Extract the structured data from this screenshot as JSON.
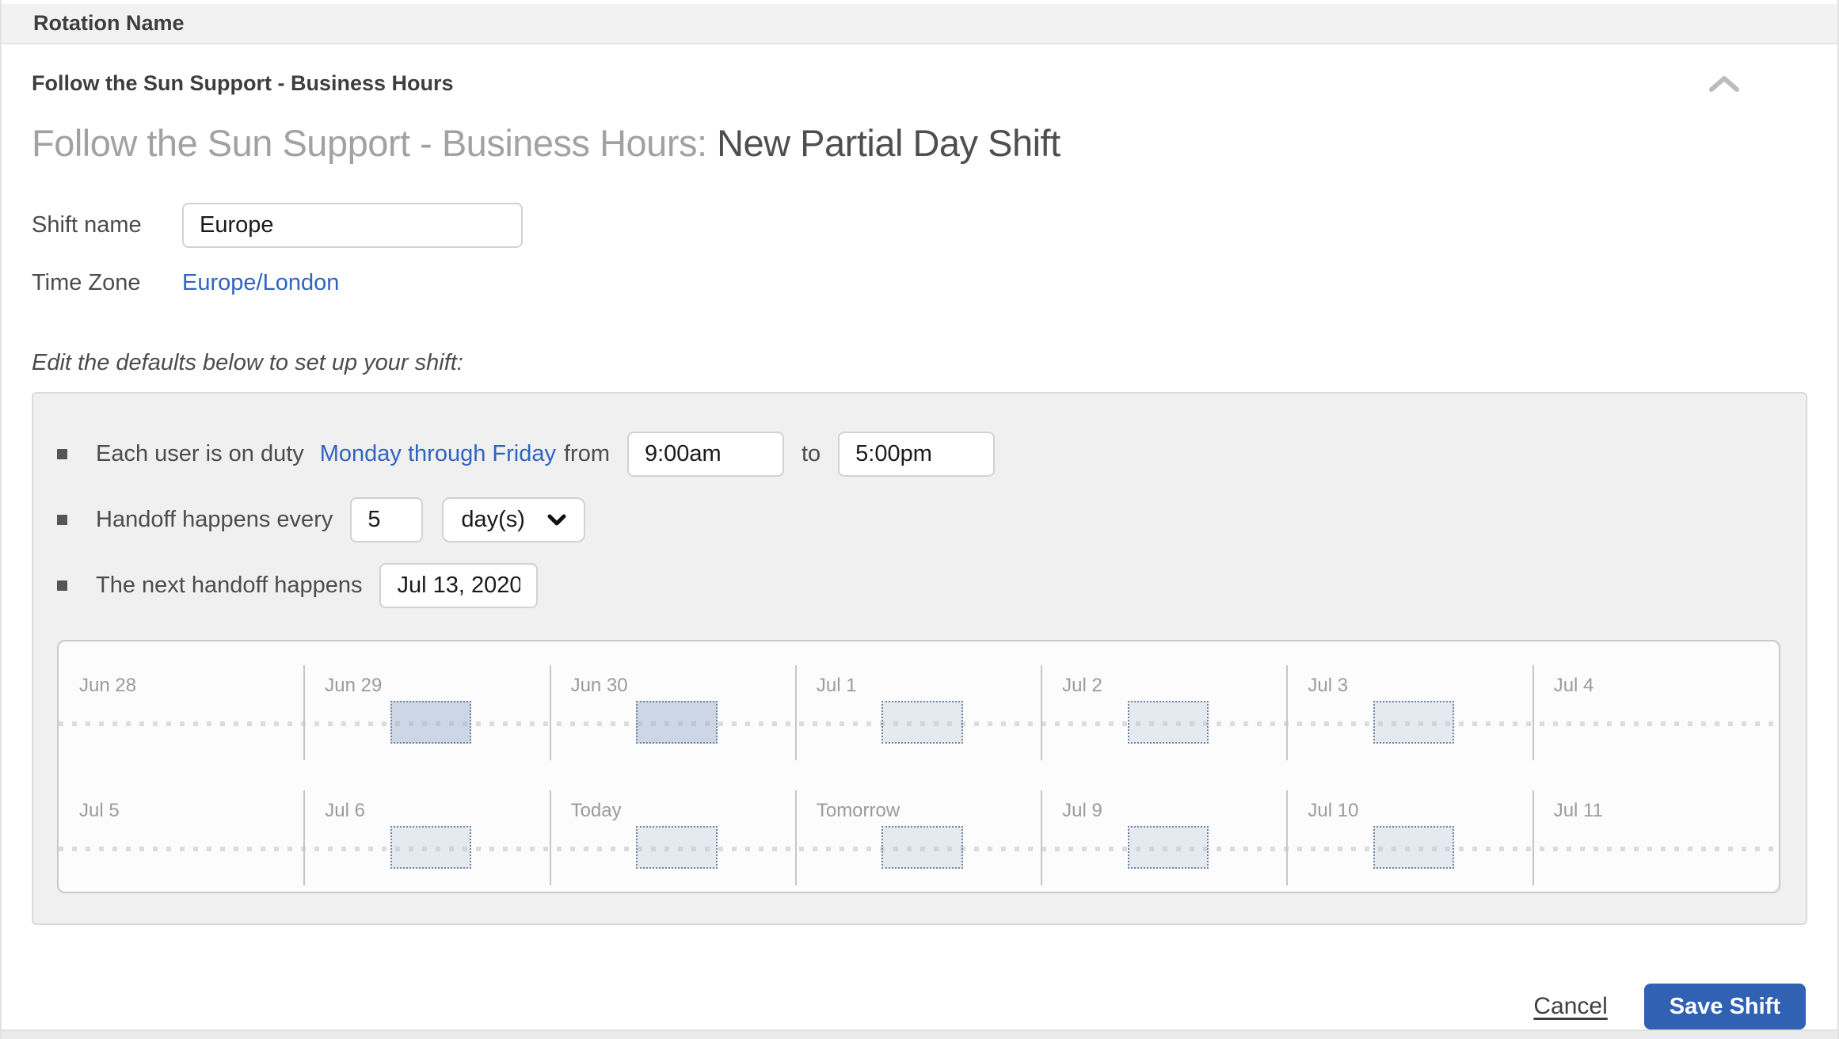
{
  "page": {
    "rotation_header": "Rotation Name"
  },
  "card": {
    "subtitle": "Follow the Sun Support - Business Hours",
    "title_prefix": "Follow the Sun Support - Business Hours:",
    "title_emphasis": "New Partial Day Shift",
    "shift_name": {
      "label": "Shift name",
      "value": "Europe"
    },
    "time_zone": {
      "label": "Time Zone",
      "value": "Europe/London"
    },
    "note": "Edit the defaults below to set up your shift:"
  },
  "defaults": {
    "duty": {
      "prefix": "Each user is on duty",
      "days_link": "Monday through Friday",
      "from_label": "from",
      "start_value": "9:00am",
      "to_label": "to",
      "end_value": "5:00pm"
    },
    "handoff": {
      "label": "Handoff happens every",
      "interval_value": "5",
      "unit_value": "day(s)"
    },
    "next_handoff": {
      "label": "The next handoff happens",
      "date_value": "Jul 13, 2020"
    }
  },
  "calendar": {
    "rows": [
      {
        "days": [
          {
            "label": "Jun 28",
            "has_shift": false
          },
          {
            "label": "Jun 29",
            "has_shift": true,
            "variant": "past"
          },
          {
            "label": "Jun 30",
            "has_shift": true,
            "variant": "past"
          },
          {
            "label": "Jul 1",
            "has_shift": true,
            "variant": "future"
          },
          {
            "label": "Jul 2",
            "has_shift": true,
            "variant": "future"
          },
          {
            "label": "Jul 3",
            "has_shift": true,
            "variant": "future"
          },
          {
            "label": "Jul 4",
            "has_shift": false
          }
        ]
      },
      {
        "days": [
          {
            "label": "Jul 5",
            "has_shift": false
          },
          {
            "label": "Jul 6",
            "has_shift": true,
            "variant": "future"
          },
          {
            "label": "Today",
            "has_shift": true,
            "variant": "future"
          },
          {
            "label": "Tomorrow",
            "has_shift": true,
            "variant": "future"
          },
          {
            "label": "Jul 9",
            "has_shift": true,
            "variant": "future"
          },
          {
            "label": "Jul 10",
            "has_shift": true,
            "variant": "future"
          },
          {
            "label": "Jul 11",
            "has_shift": false
          }
        ]
      }
    ]
  },
  "footer": {
    "cancel_label": "Cancel",
    "save_label": "Save Shift"
  },
  "colors": {
    "accent_blue": "#3161b3",
    "link_blue": "#3064c0",
    "panel_gray": "#f0f0f0"
  }
}
